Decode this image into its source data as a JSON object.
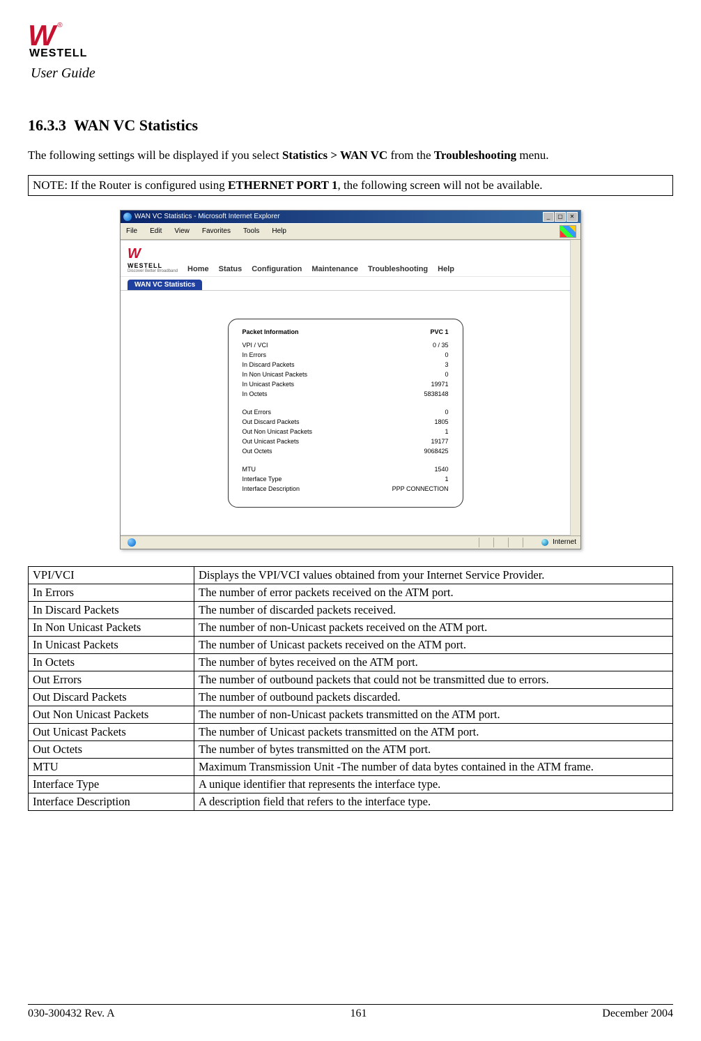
{
  "header": {
    "brand_glyph": "W",
    "brand_text": "WESTELL",
    "registered": "®",
    "guide_title": "User Guide"
  },
  "section": {
    "number": "16.3.3",
    "title": "WAN VC Statistics",
    "intro_prefix": "The following settings will be displayed if you select ",
    "intro_bold1": "Statistics > WAN VC",
    "intro_mid": " from the ",
    "intro_bold2": "Troubleshooting",
    "intro_suffix": " menu.",
    "note_prefix": "NOTE: If the Router is configured using ",
    "note_bold": "ETHERNET PORT 1",
    "note_suffix": ", the following screen will not be available."
  },
  "ie_window": {
    "title": "WAN VC Statistics - Microsoft Internet Explorer",
    "menus": [
      "File",
      "Edit",
      "View",
      "Favorites",
      "Tools",
      "Help"
    ],
    "win_min": "_",
    "win_max": "▢",
    "win_close": "✕",
    "status_text": "Internet"
  },
  "router_ui": {
    "logo_glyph": "W",
    "logo_text": "WESTELL",
    "logo_sub": "Discover Better Broadband",
    "nav": [
      "Home",
      "Status",
      "Configuration",
      "Maintenance",
      "Troubleshooting",
      "Help"
    ],
    "tab_label": "WAN VC Statistics",
    "panel_header_left": "Packet Information",
    "panel_header_right": "PVC 1",
    "rows_a": [
      {
        "label": "VPI / VCI",
        "value": "0 / 35"
      },
      {
        "label": "In Errors",
        "value": "0"
      },
      {
        "label": "In Discard Packets",
        "value": "3"
      },
      {
        "label": "In Non Unicast Packets",
        "value": "0"
      },
      {
        "label": "In Unicast Packets",
        "value": "19971"
      },
      {
        "label": "In Octets",
        "value": "5838148"
      }
    ],
    "rows_b": [
      {
        "label": "Out Errors",
        "value": "0"
      },
      {
        "label": "Out Discard Packets",
        "value": "1805"
      },
      {
        "label": "Out Non Unicast Packets",
        "value": "1"
      },
      {
        "label": "Out Unicast Packets",
        "value": "19177"
      },
      {
        "label": "Out Octets",
        "value": "9068425"
      }
    ],
    "rows_c": [
      {
        "label": "MTU",
        "value": "1540"
      },
      {
        "label": "Interface Type",
        "value": "1"
      },
      {
        "label": "Interface Description",
        "value": "PPP CONNECTION"
      }
    ]
  },
  "desc_table": [
    {
      "term": "VPI/VCI",
      "desc": "Displays the VPI/VCI values obtained from your Internet Service Provider."
    },
    {
      "term": "In Errors",
      "desc": "The number of error packets received on the ATM port."
    },
    {
      "term": "In Discard Packets",
      "desc": "The number of discarded packets received."
    },
    {
      "term": "In Non Unicast Packets",
      "desc": "The number of non-Unicast packets received on the ATM port."
    },
    {
      "term": "In Unicast Packets",
      "desc": "The number of Unicast packets received on the ATM port."
    },
    {
      "term": "In Octets",
      "desc": "The number of bytes received on the ATM port."
    },
    {
      "term": "Out Errors",
      "desc": "The number of outbound packets that could not be transmitted due to errors."
    },
    {
      "term": "Out Discard Packets",
      "desc": "The number of outbound packets discarded."
    },
    {
      "term": "Out Non Unicast Packets",
      "desc": "The number of non-Unicast packets transmitted on the ATM port."
    },
    {
      "term": "Out Unicast Packets",
      "desc": "The number of Unicast packets transmitted on the ATM port."
    },
    {
      "term": "Out Octets",
      "desc": "The number of bytes transmitted on the ATM port."
    },
    {
      "term": "MTU",
      "desc": "Maximum Transmission Unit -The number of data bytes contained in the ATM frame."
    },
    {
      "term": "Interface Type",
      "desc": "A unique identifier that represents the interface type."
    },
    {
      "term": "Interface Description",
      "desc": "A description field that refers to the interface type."
    }
  ],
  "footer": {
    "left": "030-300432 Rev. A",
    "center": "161",
    "right": "December 2004"
  }
}
